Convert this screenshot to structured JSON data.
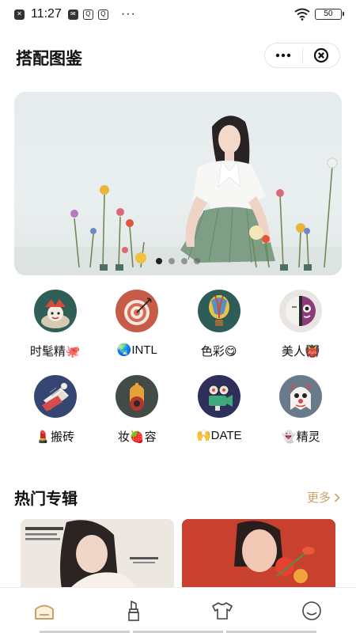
{
  "status_bar": {
    "time": "11:27",
    "more": "···",
    "battery": "50"
  },
  "header": {
    "title": "搭配图鉴"
  },
  "banner": {
    "slide_count": 4,
    "active_slide": 1
  },
  "categories": [
    {
      "label": "时髦精🐙",
      "icon": "fashion-mask-icon",
      "bg": "#2f5f56"
    },
    {
      "label": "🌏INTL",
      "icon": "target-icon",
      "bg": "#c65c47"
    },
    {
      "label": "色彩😋",
      "icon": "balloon-icon",
      "bg": "#2e5d57"
    },
    {
      "label": "美人👹",
      "icon": "face-icon",
      "bg": "#e8e5e2"
    },
    {
      "label": "💄搬砖",
      "icon": "papers-icon",
      "bg": "#354672"
    },
    {
      "label": "妆🍓容",
      "icon": "makeup-icon",
      "bg": "#424b46"
    },
    {
      "label": "🙌DATE",
      "icon": "camera-icon",
      "bg": "#2e2f5a"
    },
    {
      "label": "👻精灵",
      "icon": "ghost-icon",
      "bg": "#697b8b"
    }
  ],
  "section": {
    "title": "热门专辑",
    "more_label": "更多",
    "accent": "#c9a26b"
  },
  "tabs": [
    {
      "name": "home",
      "active": true
    },
    {
      "name": "lipstick",
      "active": false
    },
    {
      "name": "clothes",
      "active": false
    },
    {
      "name": "profile",
      "active": false
    }
  ],
  "colors": {
    "tab_active": "#c9a26b",
    "tab_inactive": "#444444"
  }
}
